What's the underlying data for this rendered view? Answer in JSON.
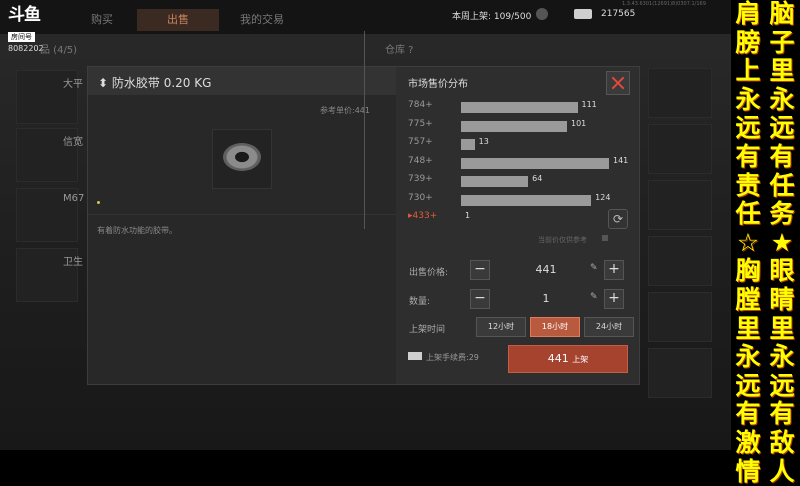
{
  "stream": {
    "brand": "斗鱼",
    "room_tag": "房间号",
    "room_id": "8082202"
  },
  "topbar": {
    "tabs": [
      {
        "label": "购买"
      },
      {
        "label": "出售"
      },
      {
        "label": "我的交易"
      }
    ],
    "weekly_label": "本周上架:",
    "weekly_value": "109/500",
    "money": "217565",
    "tiny": "1.3.43.6301(12691)8)0307.1/169"
  },
  "left_panel": {
    "count_label": "品 (4/5)",
    "items": [
      {
        "name": "大平"
      },
      {
        "name": "信宽"
      },
      {
        "name": "M67"
      },
      {
        "name": "卫生"
      }
    ]
  },
  "right_panel": {
    "title": "仓库 ?"
  },
  "dialog": {
    "item_name": "防水胶带 0.20 KG",
    "ref_price": "参考单价:441",
    "desc": "有着防水功能的胶带。",
    "market_title": "市场售价分布",
    "distribution": [
      {
        "price": "784+",
        "count": 111,
        "active": false
      },
      {
        "price": "775+",
        "count": 101,
        "active": false
      },
      {
        "price": "757+",
        "count": 13,
        "active": false
      },
      {
        "price": "748+",
        "count": 141,
        "active": false
      },
      {
        "price": "739+",
        "count": 64,
        "active": false
      },
      {
        "price": "730+",
        "count": 124,
        "active": false
      },
      {
        "price": "433+",
        "count": 1,
        "active": true
      }
    ],
    "hint": "当前价仅供参考",
    "price_label": "出售价格:",
    "price_value": "441",
    "qty_label": "数量:",
    "qty_value": "1",
    "time_label": "上架时间",
    "time_options": [
      "12小时",
      "18小时",
      "24小时"
    ],
    "fee": "上架手续费:29",
    "list_amount": "441",
    "list_suffix": "上架"
  },
  "banner": {
    "left_col": "肩膀上永远有责任☆胸膛里永远有激情",
    "right_col": "脑子里永远有任务★眼睛里永远有敌人"
  }
}
